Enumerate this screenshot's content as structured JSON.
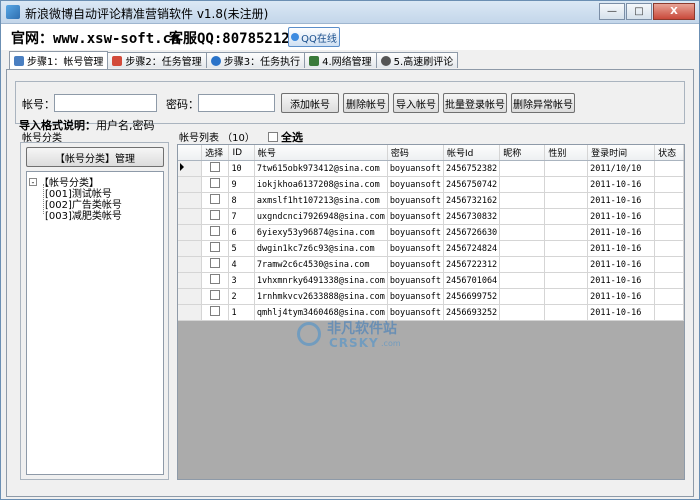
{
  "window": {
    "title": "新浪微博自动评论精准营销软件 v1.8(未注册)",
    "controls": {
      "minimize": "—",
      "maximize": "□",
      "close": "X"
    }
  },
  "header": {
    "site": "官网：www.xsw-soft.cn",
    "service": "客服QQ:807852129",
    "qq_button": "QQ在线"
  },
  "tabs": [
    {
      "label": "步骤1：帐号管理",
      "icon": "user-card-icon",
      "color": "#4a7fc1",
      "active": true
    },
    {
      "label": "步骤2：任务管理",
      "icon": "calendar-icon",
      "color": "#d24a3a",
      "active": false
    },
    {
      "label": "步骤3：任务执行",
      "icon": "globe-icon",
      "color": "#2a73c9",
      "active": false
    },
    {
      "label": "4.网络管理",
      "icon": "network-icon",
      "color": "#3a7a3a",
      "active": false
    },
    {
      "label": "5.高速刷评论",
      "icon": "disc-icon",
      "color": "#555555",
      "active": false
    }
  ],
  "form": {
    "account_label": "帐号：",
    "account_value": "",
    "password_label": "密码：",
    "password_value": "",
    "buttons": {
      "add": "添加帐号",
      "delete": "删除帐号",
      "import": "导入帐号",
      "batch_login": "批量登录帐号",
      "delete_abnormal": "删除异常帐号"
    }
  },
  "import_note": {
    "label": "导入格式说明：",
    "text": "用户名,密码"
  },
  "category": {
    "group_label": "帐号分类",
    "manage_button": "【帐号分类】管理",
    "tree_root": "【帐号分类】",
    "tree_toggle": "-",
    "tree_items": [
      "[001]测试帐号",
      "[002]广告类帐号",
      "[003]减肥类帐号"
    ]
  },
  "account_list": {
    "label": "帐号列表 （10）",
    "select_all": "全选",
    "columns": [
      "选择",
      "ID",
      "帐号",
      "密码",
      "帐号Id",
      "昵称",
      "性别",
      "登录时间",
      "状态"
    ],
    "rows": [
      {
        "id": "10",
        "account": "7tw615obk973412@sina.com",
        "password": "boyuansoft",
        "account_id": "2456752382",
        "nickname": "",
        "gender": "",
        "login_time": "2011/10/10",
        "status": ""
      },
      {
        "id": "9",
        "account": "iokjkhoa6137208@sina.com",
        "password": "boyuansoft",
        "account_id": "2456750742",
        "nickname": "",
        "gender": "",
        "login_time": "2011-10-16",
        "status": ""
      },
      {
        "id": "8",
        "account": "axmslf1ht107213@sina.com",
        "password": "boyuansoft",
        "account_id": "2456732162",
        "nickname": "",
        "gender": "",
        "login_time": "2011-10-16",
        "status": ""
      },
      {
        "id": "7",
        "account": "uxgndcnci7926948@sina.com",
        "password": "boyuansoft",
        "account_id": "2456730832",
        "nickname": "",
        "gender": "",
        "login_time": "2011-10-16",
        "status": ""
      },
      {
        "id": "6",
        "account": "6yiexy53y96874@sina.com",
        "password": "boyuansoft",
        "account_id": "2456726630",
        "nickname": "",
        "gender": "",
        "login_time": "2011-10-16",
        "status": ""
      },
      {
        "id": "5",
        "account": "dwgin1kc7z6c93@sina.com",
        "password": "boyuansoft",
        "account_id": "2456724824",
        "nickname": "",
        "gender": "",
        "login_time": "2011-10-16",
        "status": ""
      },
      {
        "id": "4",
        "account": "7ramw2c6c4530@sina.com",
        "password": "boyuansoft",
        "account_id": "2456722312",
        "nickname": "",
        "gender": "",
        "login_time": "2011-10-16",
        "status": ""
      },
      {
        "id": "3",
        "account": "1vhxmnrky6491338@sina.com",
        "password": "boyuansoft",
        "account_id": "2456701064",
        "nickname": "",
        "gender": "",
        "login_time": "2011-10-16",
        "status": ""
      },
      {
        "id": "2",
        "account": "1rnhmkvcv2633888@sina.com",
        "password": "boyuansoft",
        "account_id": "2456699752",
        "nickname": "",
        "gender": "",
        "login_time": "2011-10-16",
        "status": ""
      },
      {
        "id": "1",
        "account": "qmhlj4tym3460468@sina.com",
        "password": "boyuansoft",
        "account_id": "2456693252",
        "nickname": "",
        "gender": "",
        "login_time": "2011-10-16",
        "status": ""
      }
    ]
  },
  "watermark": {
    "cn": "非凡软件站",
    "en": "CRSKY",
    "suffix": ".com"
  }
}
